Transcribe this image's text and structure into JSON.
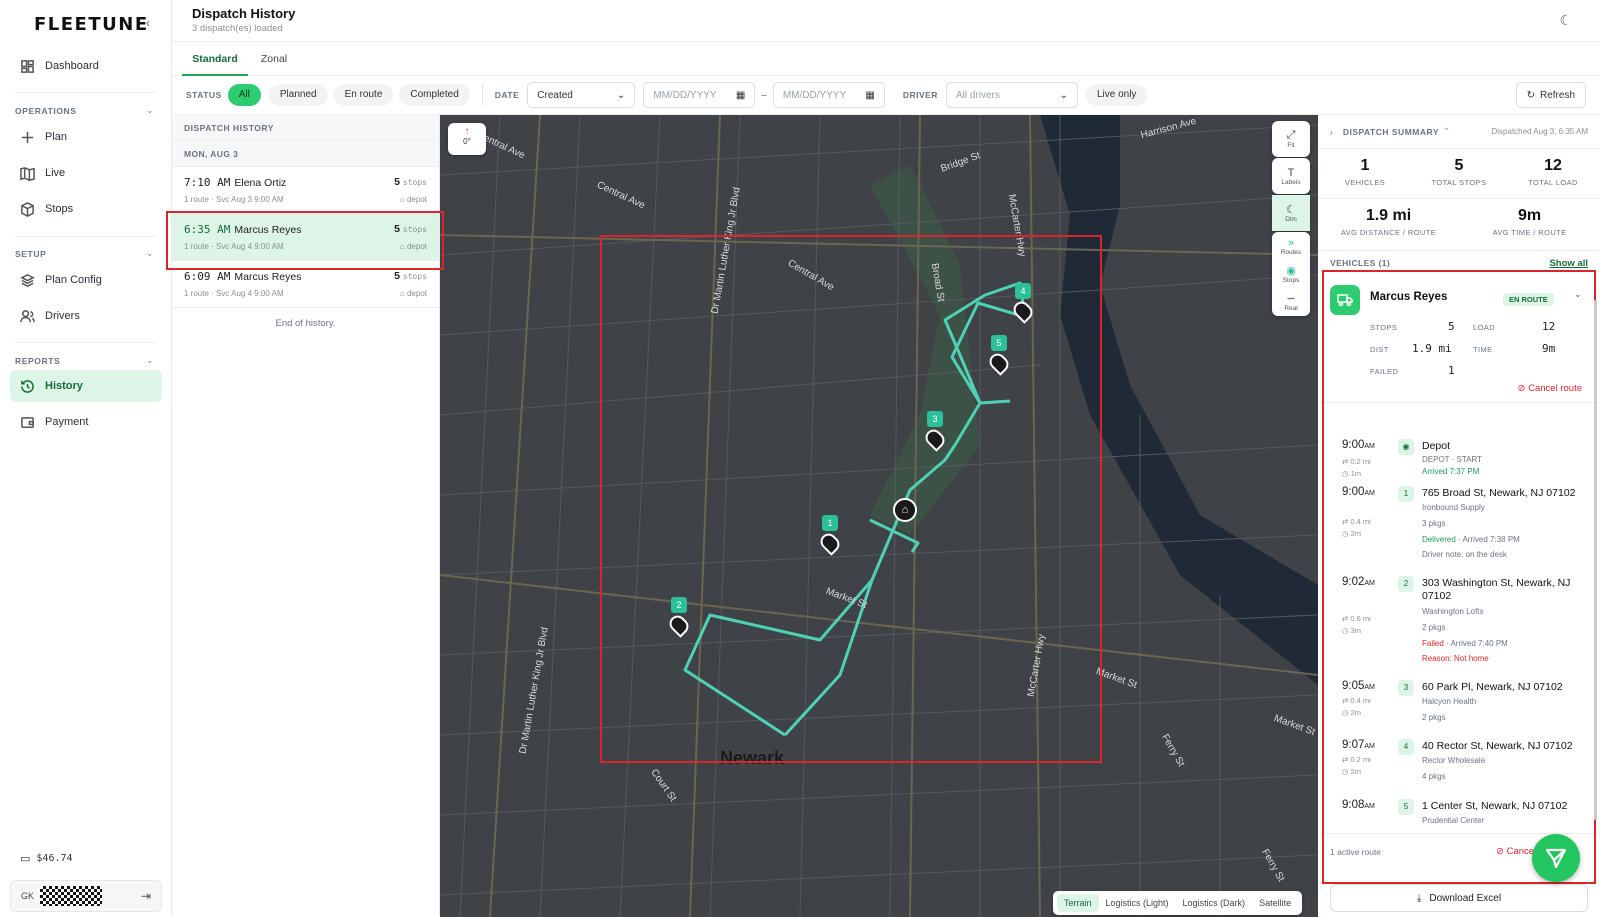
{
  "brand": {
    "logo": "FLEETUNE",
    "collapse_icon": "chevron-left-icon"
  },
  "sidebar": {
    "items": [
      {
        "label": "Dashboard",
        "icon": "dashboard-icon"
      },
      {
        "label": "Plan",
        "icon": "plus-icon"
      },
      {
        "label": "Live",
        "icon": "map-icon"
      },
      {
        "label": "Stops",
        "icon": "cube-icon"
      },
      {
        "label": "Plan Config",
        "icon": "layers-icon"
      },
      {
        "label": "Drivers",
        "icon": "users-icon"
      },
      {
        "label": "History",
        "icon": "history-icon"
      },
      {
        "label": "Payment",
        "icon": "wallet-icon"
      }
    ],
    "sections": {
      "operations": "OPERATIONS",
      "setup": "SETUP",
      "reports": "REPORTS"
    },
    "balance": "$46.74",
    "user_initials": "GK"
  },
  "header": {
    "title": "Dispatch History",
    "subtitle": "3 dispatch(es) loaded"
  },
  "tabs": [
    "Standard",
    "Zonal"
  ],
  "filters": {
    "status_label": "STATUS",
    "statuses": [
      "All",
      "Planned",
      "En route",
      "Completed"
    ],
    "date_label": "DATE",
    "date_type": "Created",
    "date_from_placeholder": "MM/DD/YYYY",
    "date_to_placeholder": "MM/DD/YYYY",
    "date_sep": "–",
    "driver_label": "DRIVER",
    "driver_value": "All drivers",
    "live_only": "Live only",
    "refresh": "Refresh"
  },
  "history": {
    "heading": "DISPATCH HISTORY",
    "date_group": "MON, AUG 3",
    "rows": [
      {
        "time": "7:10 AM",
        "driver": "Elena Ortiz",
        "routes": "1 route",
        "svc": "Svc Aug 3 9:00 AM",
        "stops": "5",
        "stops_unit": "stops",
        "depot": "depot"
      },
      {
        "time": "6:35 AM",
        "driver": "Marcus Reyes",
        "routes": "1 route",
        "svc": "Svc Aug 4 9:00 AM",
        "stops": "5",
        "stops_unit": "stops",
        "depot": "depot"
      },
      {
        "time": "6:09 AM",
        "driver": "Marcus Reyes",
        "routes": "1 route",
        "svc": "Svc Aug 4 9:00 AM",
        "stops": "5",
        "stops_unit": "stops",
        "depot": "depot"
      }
    ],
    "end": "End of history."
  },
  "map": {
    "compass": "0°",
    "controls": [
      "Fit",
      "Labels",
      "Dim",
      "Routes",
      "Stops",
      "Real"
    ],
    "types": [
      "Terrain",
      "Logistics (Light)",
      "Logistics (Dark)",
      "Satellite"
    ],
    "active_type": "Terrain",
    "streets": [
      "Central Ave",
      "Central Ave",
      "Central Ave",
      "Dr Martin Luther King Jr Blvd",
      "Dr Martin Luther King Jr Blvd",
      "Bridge St",
      "Harrison Ave",
      "McCarter Hwy",
      "McCarter Hwy",
      "Broad St",
      "Market St",
      "Market St",
      "Market St",
      "Ferry St",
      "Ferry St",
      "Court St"
    ],
    "city": "Newark",
    "markers": [
      "1",
      "2",
      "3",
      "4",
      "5"
    ]
  },
  "summary": {
    "heading": "DISPATCH SUMMARY",
    "dispatched": "Dispatched Aug 3, 6:35 AM",
    "kpis": [
      {
        "value": "1",
        "label": "VEHICLES"
      },
      {
        "value": "5",
        "label": "TOTAL STOPS"
      },
      {
        "value": "12",
        "label": "TOTAL LOAD"
      }
    ],
    "kpis2": [
      {
        "value": "1.9 mi",
        "label": "AVG DISTANCE / ROUTE"
      },
      {
        "value": "9m",
        "label": "AVG TIME / ROUTE"
      }
    ],
    "vehicles_label": "VEHICLES (1)",
    "show_all": "Show all",
    "vehicle": {
      "name": "Marcus Reyes",
      "status": "EN ROUTE",
      "stops_label": "STOPS",
      "stops": "5",
      "load_label": "LOAD",
      "load": "12",
      "dist_label": "DIST",
      "dist": "1.9 mi",
      "time_label": "TIME",
      "time": "9m",
      "failed_label": "FAILED",
      "failed": "1",
      "cancel": "Cancel route"
    },
    "timeline": [
      {
        "time": "9:00",
        "ampm": "AM",
        "num": "",
        "addr": "Depot",
        "l1": "DEPOT · START",
        "l2": "Arrived 7:37 PM",
        "l3": "",
        "l4": "",
        "dist": "0.2 mi",
        "dur": "1m"
      },
      {
        "time": "9:00",
        "ampm": "AM",
        "num": "1",
        "addr": "765 Broad St, Newark, NJ 07102",
        "l1": "Ironbound Supply",
        "l2": "3 pkgs",
        "l3_green": "Delivered",
        "l3": " · Arrived 7:38 PM",
        "l4": "Driver note: on the desk",
        "dist": "0.4 mi",
        "dur": "2m"
      },
      {
        "time": "9:02",
        "ampm": "AM",
        "num": "2",
        "addr": "303 Washington St, Newark, NJ 07102",
        "l1": "Washington Lofts",
        "l2": "2 pkgs",
        "l3_red": "Failed",
        "l3": " · Arrived 7:40 PM",
        "l4": "Reason: Not home",
        "dist": "0.6 mi",
        "dur": "3m"
      },
      {
        "time": "9:05",
        "ampm": "AM",
        "num": "3",
        "addr": "60 Park Pl, Newark, NJ 07102",
        "l1": "Halcyon Health",
        "l2": "2 pkgs",
        "dist": "0.4 mi",
        "dur": "2m"
      },
      {
        "time": "9:07",
        "ampm": "AM",
        "num": "4",
        "addr": "40 Rector St, Newark, NJ 07102",
        "l1": "Rector Wholesale",
        "l2": "4 pkgs",
        "dist": "0.2 mi",
        "dur": "2m"
      },
      {
        "time": "9:08",
        "ampm": "AM",
        "num": "5",
        "addr": "1 Center St, Newark, NJ 07102",
        "l1": "Prudential Center"
      }
    ],
    "footer_active": "1 active route",
    "footer_cancel": "Cancel",
    "download": "Download Excel"
  },
  "colors": {
    "accent": "#2ecc71",
    "accent_dark": "#166b3c",
    "accent_bg": "#dcf5e6",
    "danger": "#d9262c",
    "map_bg": "#3f4246",
    "route": "#4fd1b5"
  }
}
